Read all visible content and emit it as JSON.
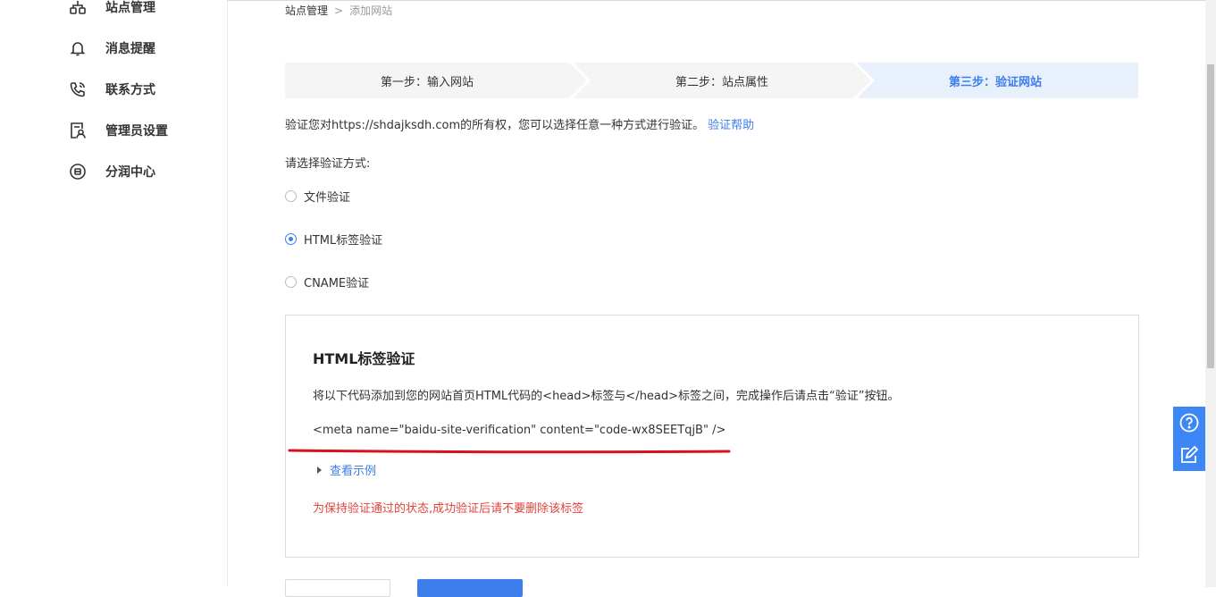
{
  "sidebar": {
    "items": [
      {
        "label": "站点管理",
        "icon": "sitemap-icon"
      },
      {
        "label": "消息提醒",
        "icon": "bell-icon"
      },
      {
        "label": "联系方式",
        "icon": "phone-icon"
      },
      {
        "label": "管理员设置",
        "icon": "admin-icon"
      },
      {
        "label": "分润中心",
        "icon": "revenue-icon"
      }
    ]
  },
  "breadcrumb": {
    "root": "站点管理",
    "separator": ">",
    "current": "添加网站"
  },
  "steps": [
    {
      "label": "第一步：输入网站",
      "active": false
    },
    {
      "label": "第二步：站点属性",
      "active": false
    },
    {
      "label": "第三步：验证网站",
      "active": true
    }
  ],
  "intro": {
    "text": "验证您对https://shdajksdh.com的所有权，您可以选择任意一种方式进行验证。",
    "help_link": "验证帮助"
  },
  "choose_label": "请选择验证方式:",
  "methods": [
    {
      "label": "文件验证",
      "checked": false
    },
    {
      "label": "HTML标签验证",
      "checked": true
    },
    {
      "label": "CNAME验证",
      "checked": false
    }
  ],
  "panel": {
    "title": "HTML标签验证",
    "description": "将以下代码添加到您的网站首页HTML代码的<head>标签与</head>标签之间，完成操作后请点击“验证”按钮。",
    "meta_code": "<meta name=\"baidu-site-verification\" content=\"code-wx8SEETqjB\" />",
    "example_link": "查看示例",
    "warning": "为保持验证通过的状态,成功验证后请不要删除该标签"
  },
  "colors": {
    "accent": "#3d7eec",
    "warning": "#e0453c",
    "annotation": "#d9111d",
    "step_bg": "#f5f5f5",
    "step_active_bg": "#e8f0fc"
  },
  "float_tools": [
    {
      "icon": "help-icon"
    },
    {
      "icon": "feedback-icon"
    }
  ]
}
